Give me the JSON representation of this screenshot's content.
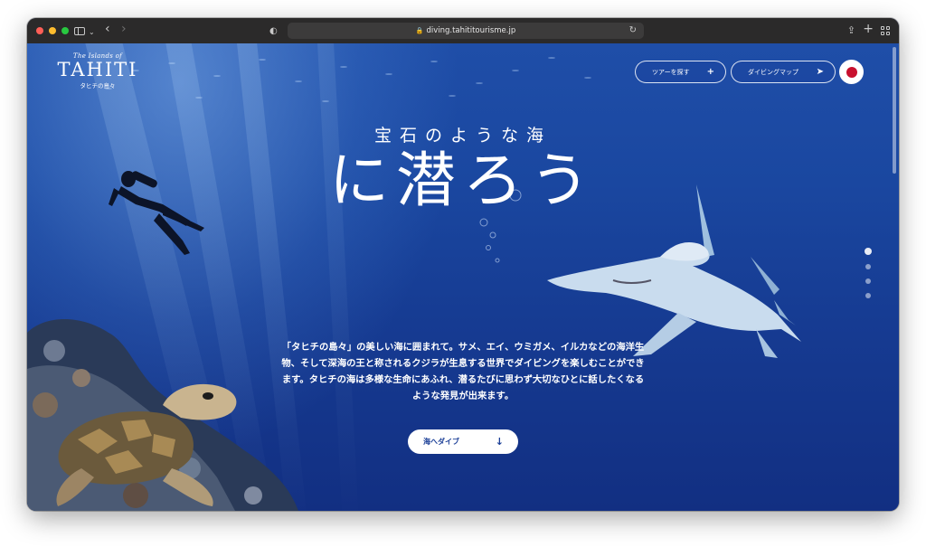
{
  "browser": {
    "url": "diving.tahititourisme.jp"
  },
  "logo": {
    "top": "The Islands of",
    "main": "TAHITI",
    "sub": "タヒチの島々"
  },
  "nav": {
    "tour_label": "ツアーを探す",
    "map_label": "ダイビングマップ"
  },
  "hero": {
    "subtitle": "宝石のような海",
    "title": "に潜ろう",
    "description": "「タヒチの島々」の美しい海に囲まれて。サメ、エイ、ウミガメ、イルカなどの海洋生物、そして深海の王と称されるクジラが生息する世界でダイビングを楽しむことができます。タヒチの海は多様な生命にあふれ、潜るたびに思わず大切なひとに話したくなるような発見が出来ます。",
    "cta_label": "海へダイブ"
  },
  "colors": {
    "accent": "#1b3f97",
    "flag": "#c8102e"
  },
  "icons": {
    "tour": "plus-icon",
    "map": "navigation-arrow-icon",
    "cta": "arrow-down-icon"
  }
}
